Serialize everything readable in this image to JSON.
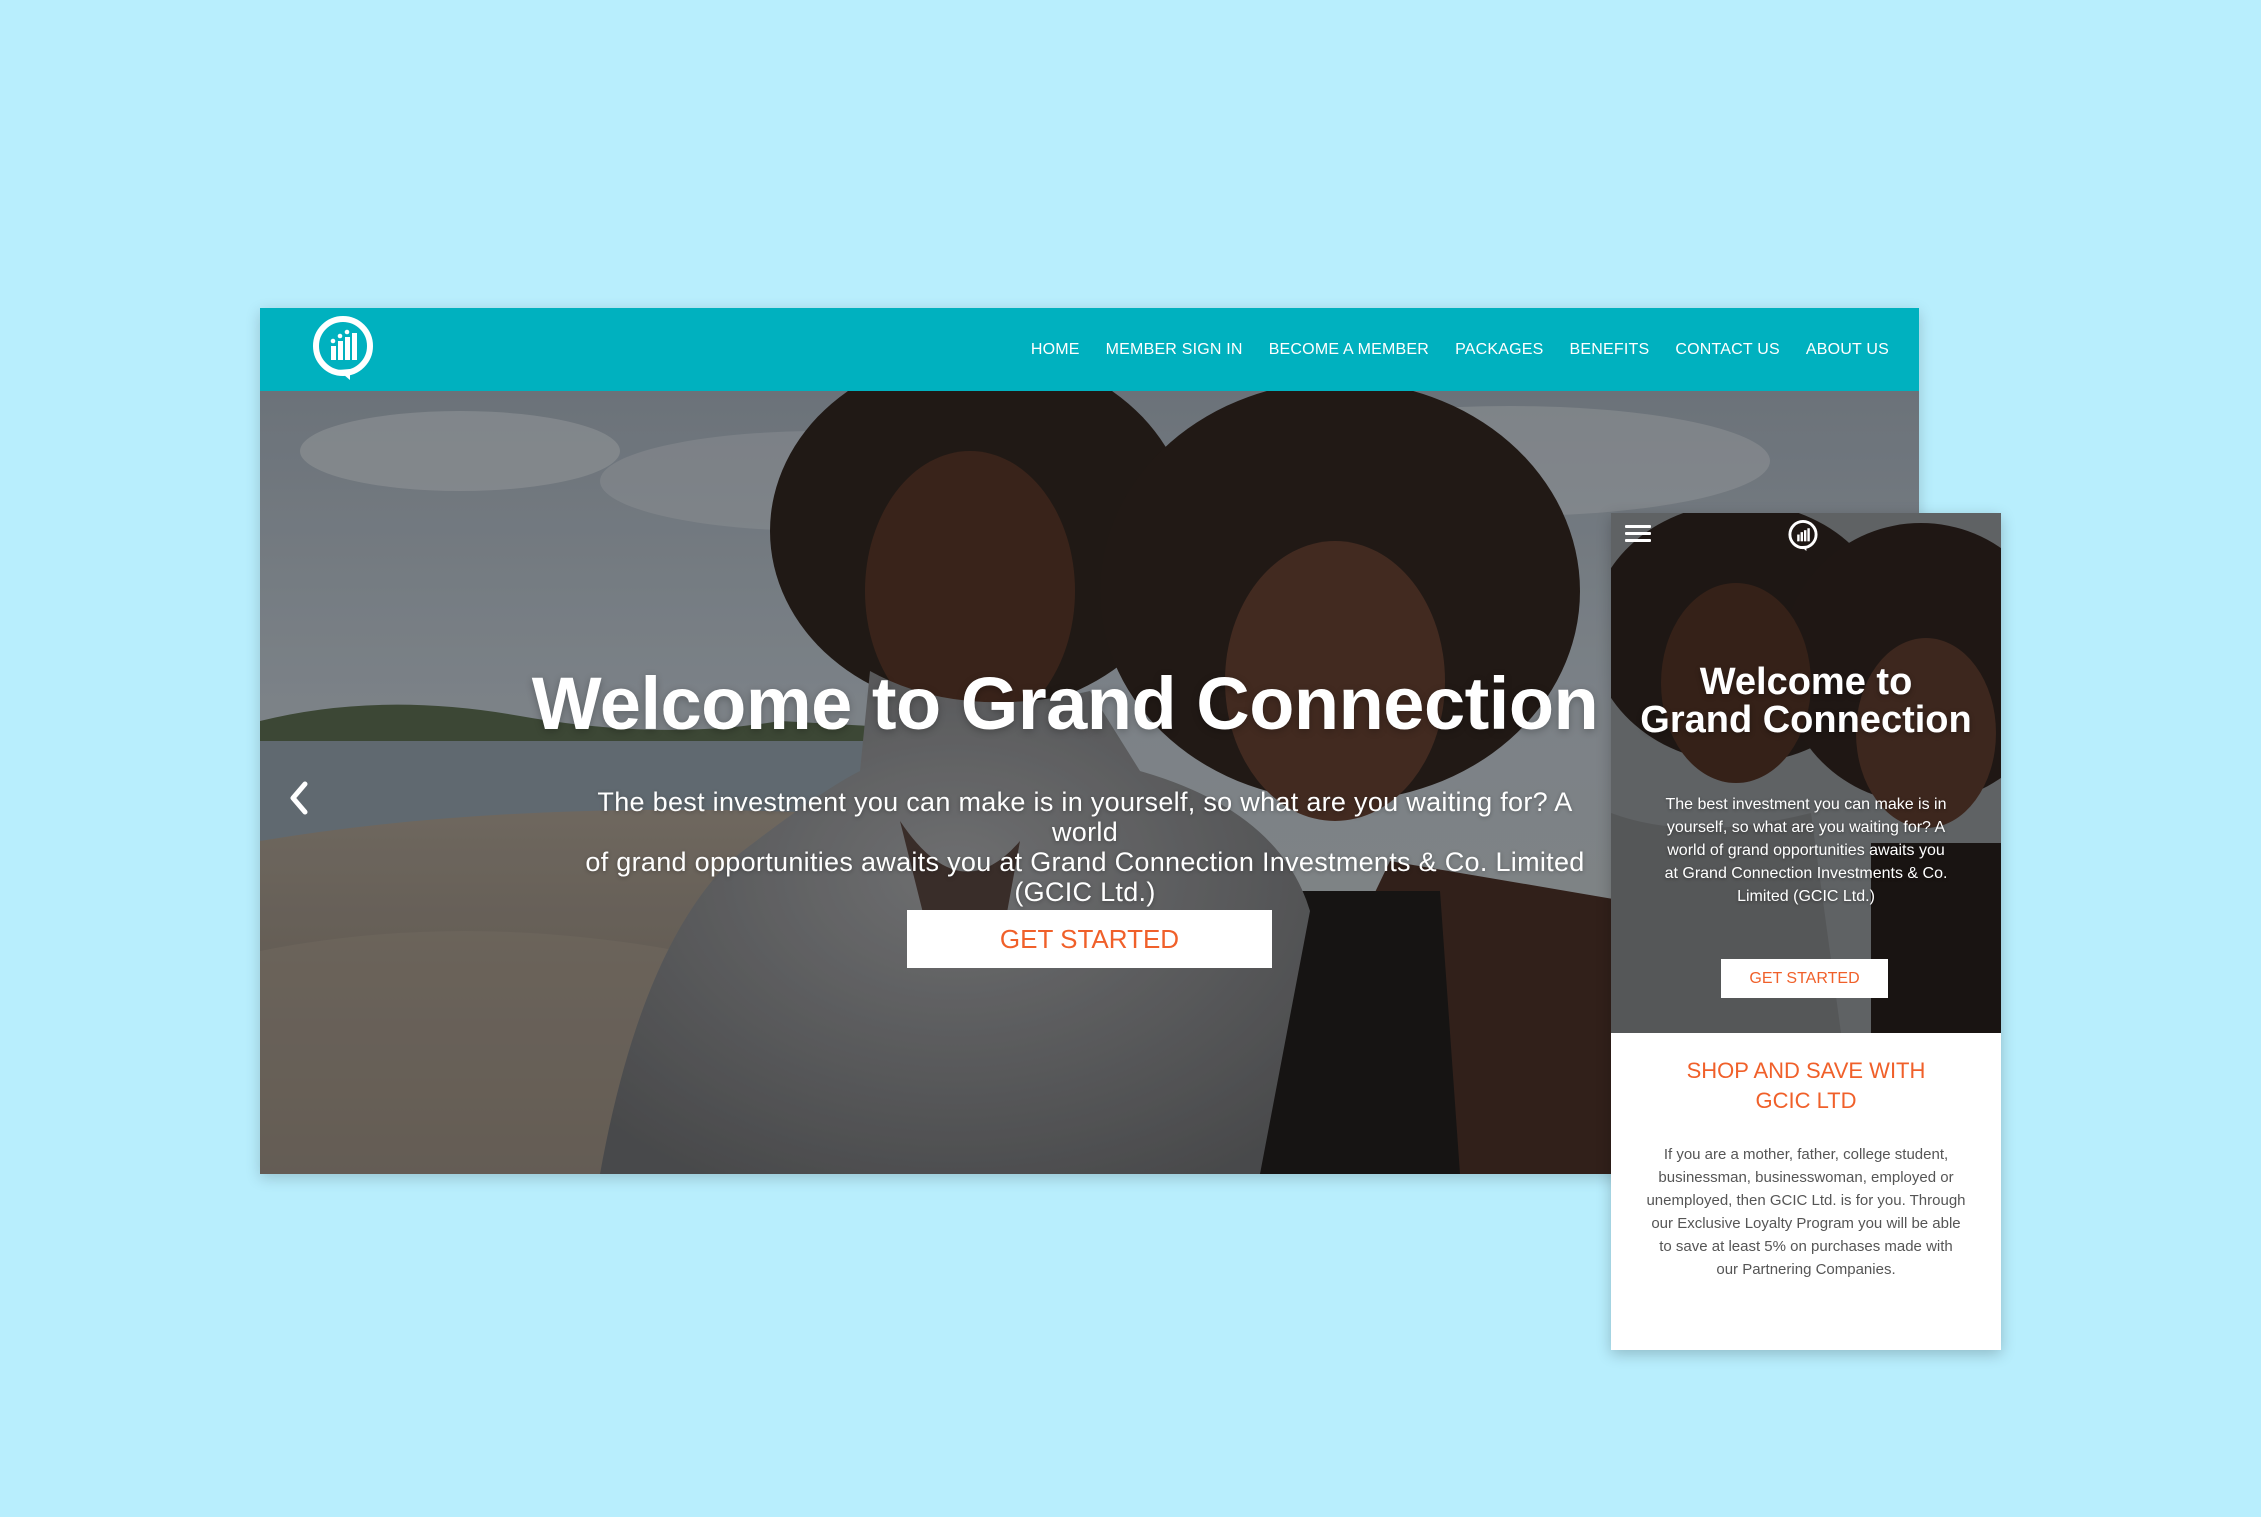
{
  "colors": {
    "background": "#b8eefd",
    "nav": "#00b1bf",
    "accent": "#f0602a",
    "text_light": "#ffffff",
    "body_text": "#555555"
  },
  "desktop": {
    "logo_icon": "chat-bubble-bar-chart-icon",
    "nav": {
      "items": [
        "HOME",
        "MEMBER SIGN IN",
        "BECOME A MEMBER",
        "PACKAGES",
        "BENEFITS",
        "CONTACT US",
        "ABOUT US"
      ]
    },
    "hero": {
      "title": "Welcome to Grand Connection",
      "subtitle_line1": "The best investment you can make is in yourself, so what are you waiting for? A world",
      "subtitle_line2": "of grand opportunities awaits you at Grand Connection Investments & Co. Limited",
      "subtitle_line3": "(GCIC Ltd.)",
      "cta": "GET STARTED",
      "prev_icon": "chevron-left-icon"
    }
  },
  "mobile": {
    "menu_icon": "hamburger-icon",
    "logo_icon": "chat-bubble-bar-chart-icon",
    "hero": {
      "title_line1": "Welcome to",
      "title_line2": "Grand Connection",
      "subtitle_line1": "The best investment you can make is in",
      "subtitle_line2": "yourself, so what are you waiting for? A",
      "subtitle_line3": "world of grand opportunities awaits you",
      "subtitle_line4": "at Grand Connection Investments & Co.",
      "subtitle_line5": "Limited (GCIC Ltd.)",
      "cta": "GET STARTED"
    },
    "section": {
      "title_line1": "SHOP AND SAVE WITH",
      "title_line2": "GCIC LTD",
      "body_line1": "If you are a mother, father, college student,",
      "body_line2": "businessman, businesswoman, employed or",
      "body_line3": "unemployed, then GCIC Ltd. is for you. Through",
      "body_line4": "our Exclusive Loyalty Program you will be able",
      "body_line5": "to save at least 5% on purchases made with",
      "body_line6": "our Partnering Companies."
    }
  }
}
